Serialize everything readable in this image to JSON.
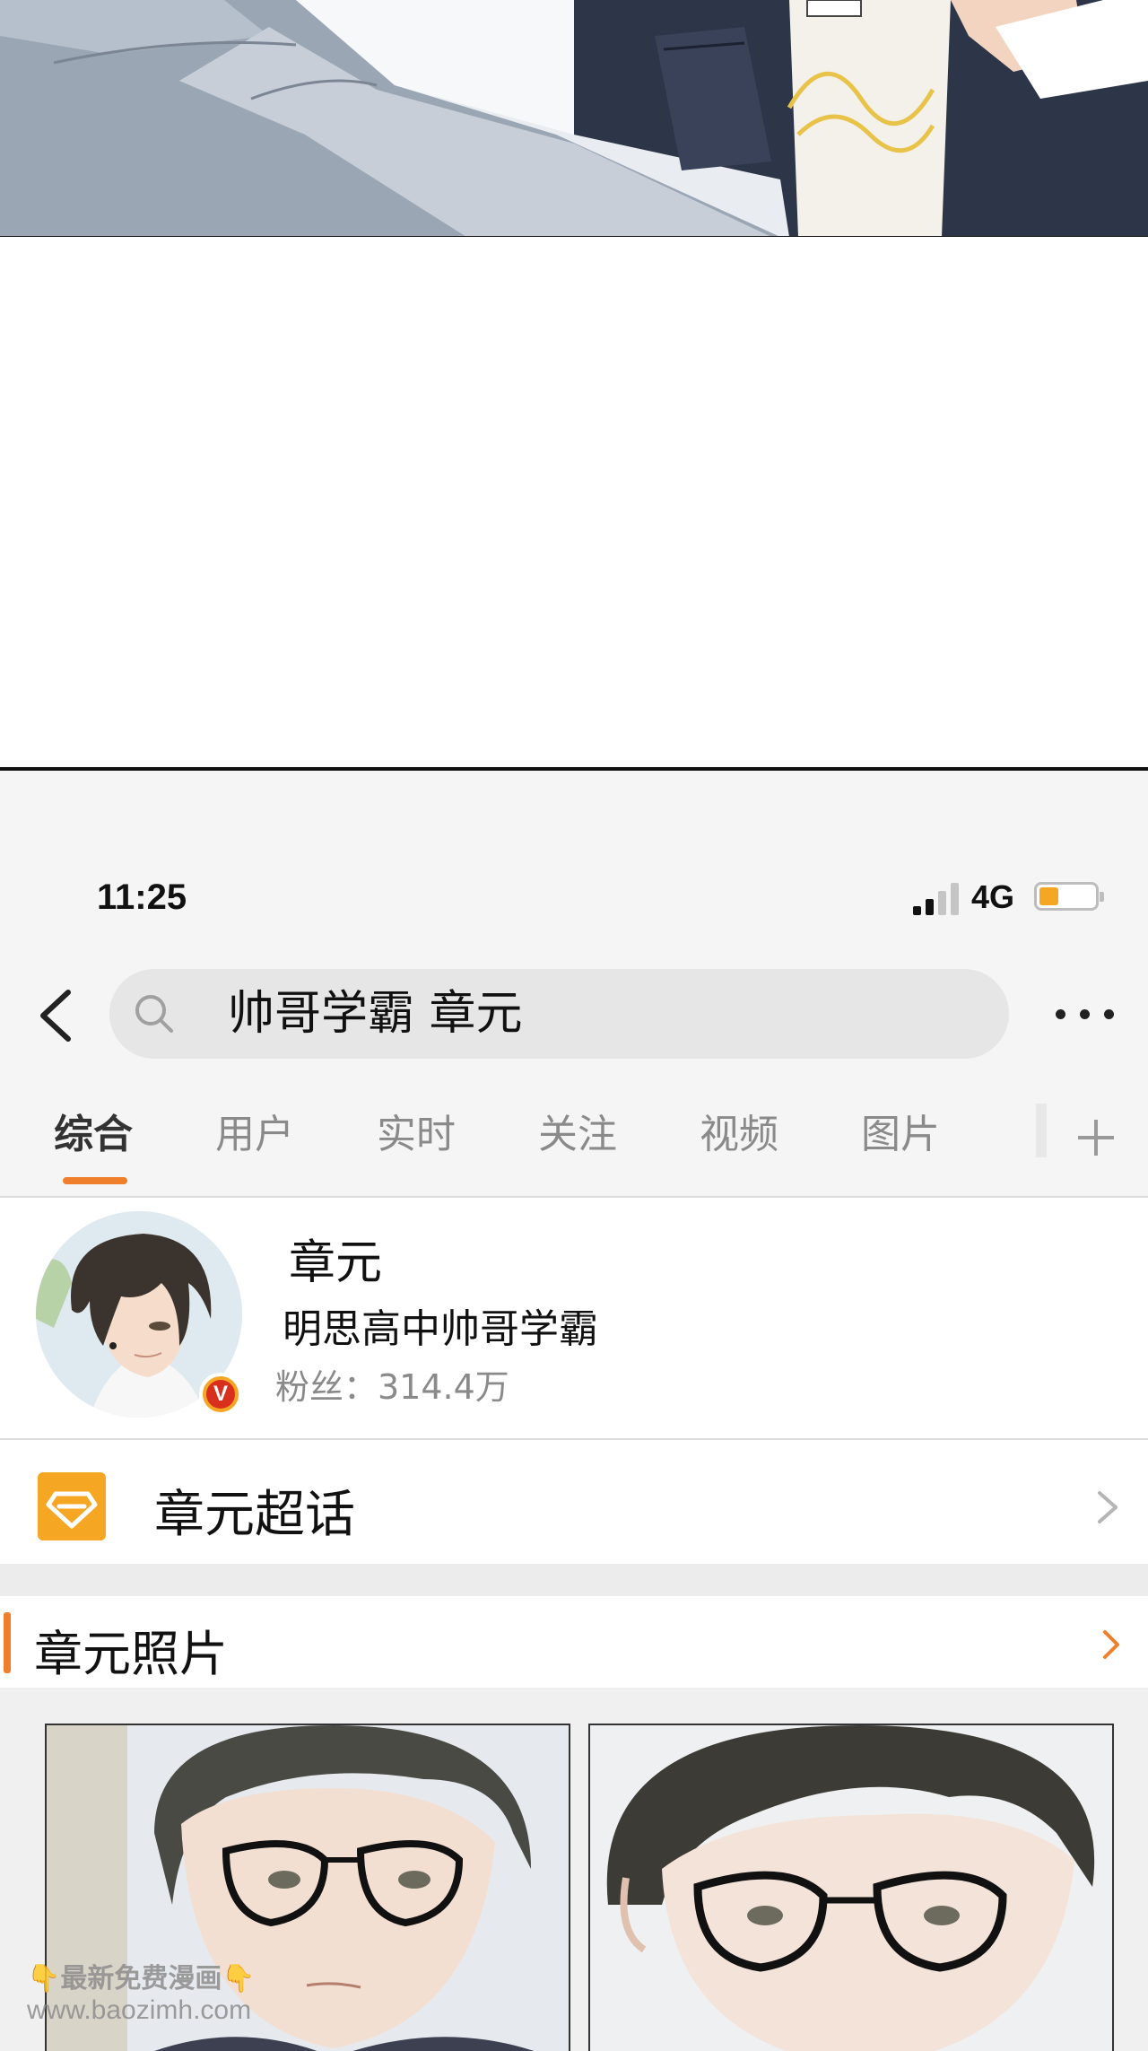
{
  "status_bar": {
    "time": "11:25",
    "network": "4G",
    "battery_level": 0.35,
    "battery_color": "#f5a623"
  },
  "search": {
    "query": "帅哥学霸 章元",
    "back_icon": "chevron-left-icon",
    "search_icon": "search-icon",
    "more_icon": "more-horizontal-icon"
  },
  "tabs": {
    "items": [
      {
        "label": "综合",
        "active": true
      },
      {
        "label": "用户",
        "active": false
      },
      {
        "label": "实时",
        "active": false
      },
      {
        "label": "关注",
        "active": false
      },
      {
        "label": "视频",
        "active": false
      },
      {
        "label": "图片",
        "active": false
      }
    ],
    "add_icon": "plus-icon",
    "accent_color": "#ef7f2a"
  },
  "user_card": {
    "name": "章元",
    "description": "明思高中帅哥学霸",
    "fans": "粉丝：314.4万",
    "verified_badge": "V"
  },
  "super_topic": {
    "label": "章元超话",
    "icon": "diamond-icon"
  },
  "photos": {
    "title": "章元照片"
  },
  "watermark": {
    "line1": "👇最新免费漫画👇",
    "line2": "www.baozimh.com"
  }
}
